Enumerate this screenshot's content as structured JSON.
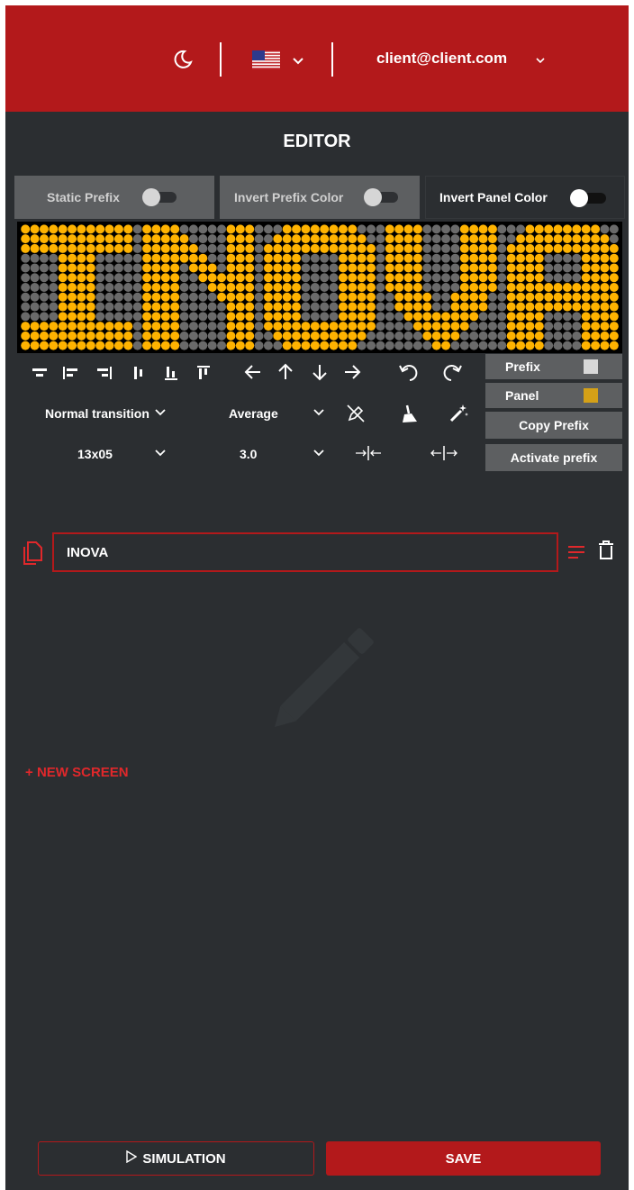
{
  "header": {
    "theme_icon": "moon-icon",
    "language_flag": "us-flag-icon",
    "user_email": "client@client.com"
  },
  "page": {
    "title": "EDITOR"
  },
  "toggles": [
    {
      "label": "Static Prefix",
      "on": false
    },
    {
      "label": "Invert Prefix Color",
      "on": false
    },
    {
      "label": "Invert Panel Color",
      "on": true
    }
  ],
  "led_panel": {
    "text": "INOVA",
    "rows": 13,
    "columns": 64,
    "active_color": "#ffb300",
    "inactive_color": "#6a6a6a"
  },
  "side_panel": {
    "prefix_label": "Prefix",
    "prefix_color": "#d8d8d8",
    "panel_label": "Panel",
    "panel_color": "#d4a017",
    "copy_prefix_label": "Copy Prefix",
    "activate_prefix_label": "Activate prefix"
  },
  "controls": {
    "transition_value": "Normal transition",
    "speed_value": "Average",
    "size_value": "13x05",
    "duration_value": "3.0"
  },
  "screens": [
    {
      "text": "INOVA"
    }
  ],
  "actions": {
    "new_screen_label": "NEW SCREEN",
    "simulation_label": "SIMULATION",
    "save_label": "SAVE"
  },
  "colors": {
    "brand_red": "#b3191b",
    "background": "#2b2e31",
    "button_gray": "#5d5f61"
  }
}
